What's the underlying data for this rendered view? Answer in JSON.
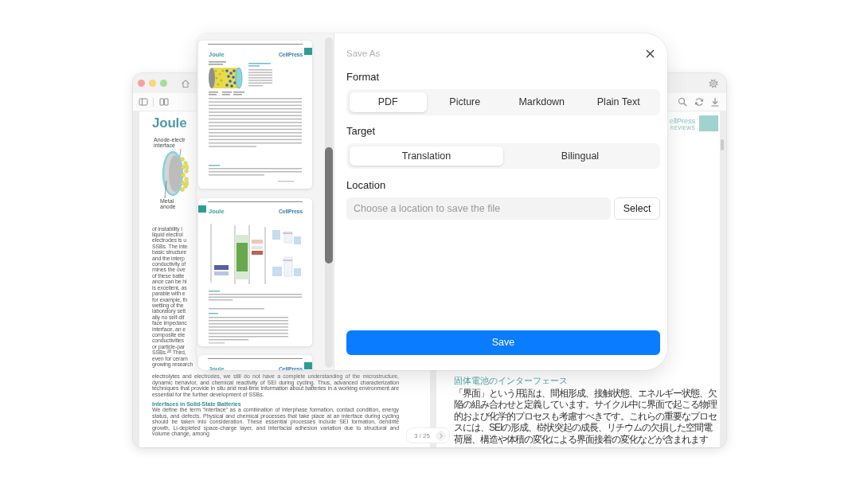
{
  "app_window": {
    "left_page": {
      "journal": "Joule",
      "figure_labels": [
        {
          "lines": [
            "Anode-electr",
            "interface"
          ]
        },
        {
          "lines": [
            "Metal",
            "anode"
          ]
        }
      ],
      "covered_lines": [
        "of instability i",
        "liquid electrol",
        "electrodes is u",
        "SSBs. The inte",
        "basic structure",
        "and the interp",
        "conductivity of",
        "mines the ove",
        "of these batte",
        "ance can be hi",
        "is excellent, as",
        "parable with e",
        "for example, th",
        "wetting of the",
        "laboratory sett",
        "ally no self-dif",
        "face impedanc",
        "interface, an e",
        "composite ele",
        "conductivities",
        "or particle-par",
        "SSBs.$^{28}$ Third,",
        "even for ceram",
        "growing research"
      ],
      "paragraphs": [
        {
          "kind": "body",
          "text": "electrolytes and electrodes, we still do not have a complete understanding of the microstructure, dynamic behavior, and chemical reactivity of SEI during cycling. Thus, advanced characterization techniques that provide in situ and real-time information about batteries in a working environment are essential for the further development of SSBs."
        },
        {
          "kind": "heading",
          "text": "Interfaces in Solid-State Batteries"
        },
        {
          "kind": "body",
          "text": "We define the term “interface” as a combination of interphase formation, contact condition, energy status, and defects. Physical and chemical processes that take place at an interface during cycling should be taken into consideration. These essential processes include SEI formation, dendrite growth, Li-depleted space-charge layer, and interfacial adhesion variation due to structural and volume change, among"
        }
      ]
    },
    "right_page": {
      "publisher": "ellPress",
      "publisher_sub": "REVIEWS",
      "heading": "固体電池のインターフェース",
      "text": "「界面」という用語は、間相形成、接触状態、エネルギー状態、欠陥の組み合わせと定義しています。サイクル中に界面で起こる物理的および化学的プロセスも考慮すべきです。これらの重要なプロセスには、SEIの形成、樹状突起の成長、リチウムの欠損した空間電荷層、構造や体積の変化による界面接着の変化などが含まれます"
    },
    "page_indicator": "3 / 25"
  },
  "thumbnails": [
    {
      "journal": "Joule",
      "publisher": "CellPress",
      "marker_left": false,
      "kind": "figure-page"
    },
    {
      "journal": "Joule",
      "publisher": "CellPress",
      "marker_left": true,
      "kind": "diagram-page"
    },
    {
      "journal": "Joule",
      "publisher": "CellPress",
      "marker_left": false,
      "kind": "cut-page"
    }
  ],
  "dialog": {
    "title": "Save As",
    "groups": [
      {
        "label": "Format",
        "kind": "segmented",
        "options": [
          {
            "label": "PDF",
            "selected": true
          },
          {
            "label": "Picture",
            "selected": false
          },
          {
            "label": "Markdown",
            "selected": false
          },
          {
            "label": "Plain Text",
            "selected": false
          }
        ]
      },
      {
        "label": "Target",
        "kind": "segmented",
        "options": [
          {
            "label": "Translation",
            "selected": true
          },
          {
            "label": "Bilingual",
            "selected": false
          }
        ]
      },
      {
        "label": "Location",
        "kind": "path",
        "placeholder": "Choose a location to save the file",
        "button": "Select"
      }
    ],
    "save_button": "Save"
  }
}
